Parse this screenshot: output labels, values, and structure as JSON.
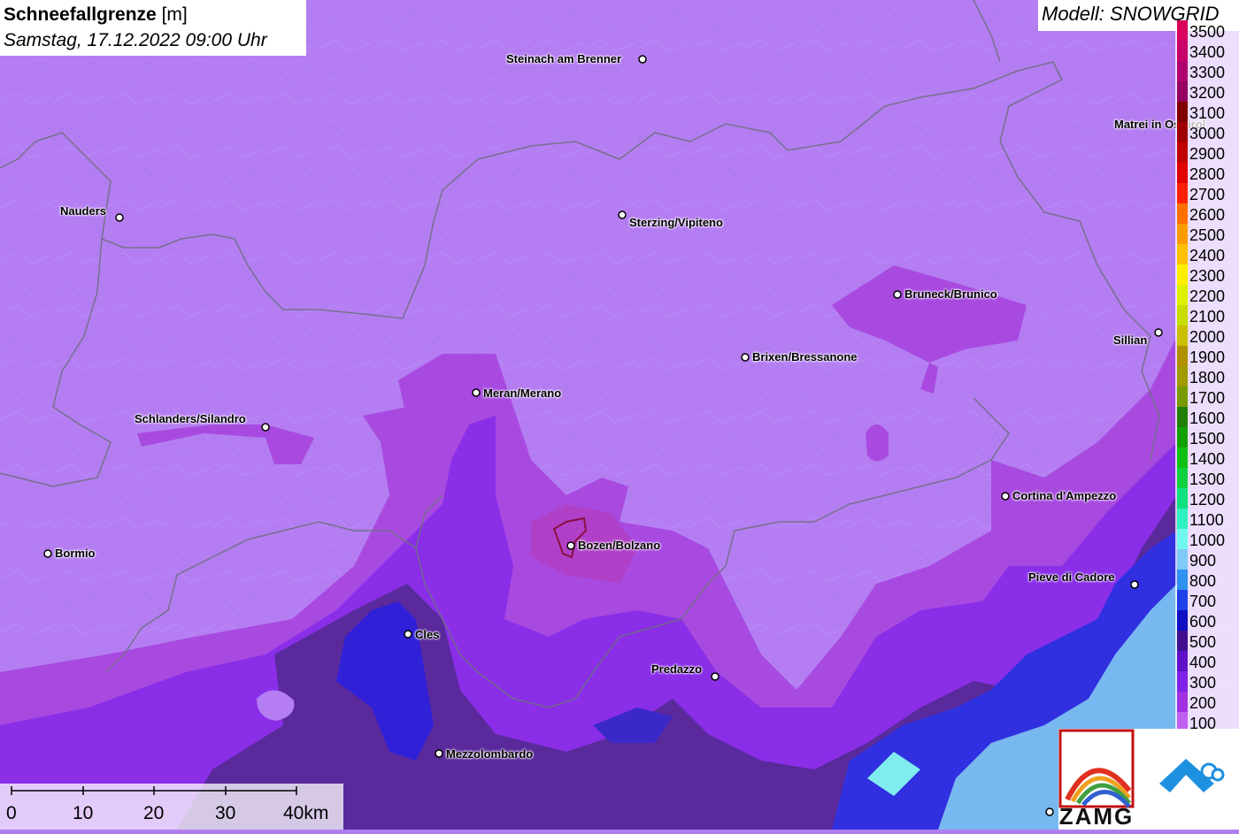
{
  "title": {
    "main": "Schneefallgrenze",
    "unit": "[m]",
    "datetime": "Samstag, 17.12.2022 09:00 Uhr"
  },
  "model": "Modell: SNOWGRID",
  "legend": [
    {
      "label": "3500",
      "color": "#d8005a"
    },
    {
      "label": "3400",
      "color": "#c8006a"
    },
    {
      "label": "3300",
      "color": "#b0006e"
    },
    {
      "label": "3200",
      "color": "#960060"
    },
    {
      "label": "3100",
      "color": "#800000"
    },
    {
      "label": "3000",
      "color": "#a00000"
    },
    {
      "label": "2900",
      "color": "#c00000"
    },
    {
      "label": "2800",
      "color": "#e00000"
    },
    {
      "label": "2700",
      "color": "#ff2000"
    },
    {
      "label": "2600",
      "color": "#ff7000"
    },
    {
      "label": "2500",
      "color": "#ff9a00"
    },
    {
      "label": "2400",
      "color": "#ffc000"
    },
    {
      "label": "2300",
      "color": "#ffee00"
    },
    {
      "label": "2200",
      "color": "#ddf000"
    },
    {
      "label": "2100",
      "color": "#c8dc00"
    },
    {
      "label": "2000",
      "color": "#c8c000"
    },
    {
      "label": "1900",
      "color": "#b09000"
    },
    {
      "label": "1800",
      "color": "#a09a00"
    },
    {
      "label": "1700",
      "color": "#789a00"
    },
    {
      "label": "1600",
      "color": "#208000"
    },
    {
      "label": "1500",
      "color": "#10a000"
    },
    {
      "label": "1400",
      "color": "#10c010"
    },
    {
      "label": "1300",
      "color": "#10d040"
    },
    {
      "label": "1200",
      "color": "#10e080"
    },
    {
      "label": "1100",
      "color": "#30f0c0"
    },
    {
      "label": "1000",
      "color": "#70f8f0"
    },
    {
      "label": "900",
      "color": "#80c8f8"
    },
    {
      "label": "800",
      "color": "#3090f0"
    },
    {
      "label": "700",
      "color": "#2040e8"
    },
    {
      "label": "600",
      "color": "#1010c0"
    },
    {
      "label": "500",
      "color": "#401090"
    },
    {
      "label": "400",
      "color": "#6010c8"
    },
    {
      "label": "300",
      "color": "#8020e8"
    },
    {
      "label": "200",
      "color": "#a030e0"
    },
    {
      "label": "100",
      "color": "#c060f0"
    }
  ],
  "cities": [
    {
      "name": "Steinach am Brenner"
    },
    {
      "name": "Nauders"
    },
    {
      "name": "Sterzing/Vipiteno"
    },
    {
      "name": "Matrei in Osttirol"
    },
    {
      "name": "Bruneck/Brunico"
    },
    {
      "name": "Sillian"
    },
    {
      "name": "Brixen/Bressanone"
    },
    {
      "name": "Meran/Merano"
    },
    {
      "name": "Schlanders/Silandro"
    },
    {
      "name": "Cortina d'Ampezzo"
    },
    {
      "name": "Bormio"
    },
    {
      "name": "Bozen/Bolzano"
    },
    {
      "name": "Pieve di Cadore"
    },
    {
      "name": "Cles"
    },
    {
      "name": "Predazzo"
    },
    {
      "name": "Mezzolombardo"
    }
  ],
  "scale": {
    "ticks": [
      "0",
      "10",
      "20",
      "30",
      "40km"
    ]
  },
  "logos": {
    "zamg": "ZAMG"
  }
}
